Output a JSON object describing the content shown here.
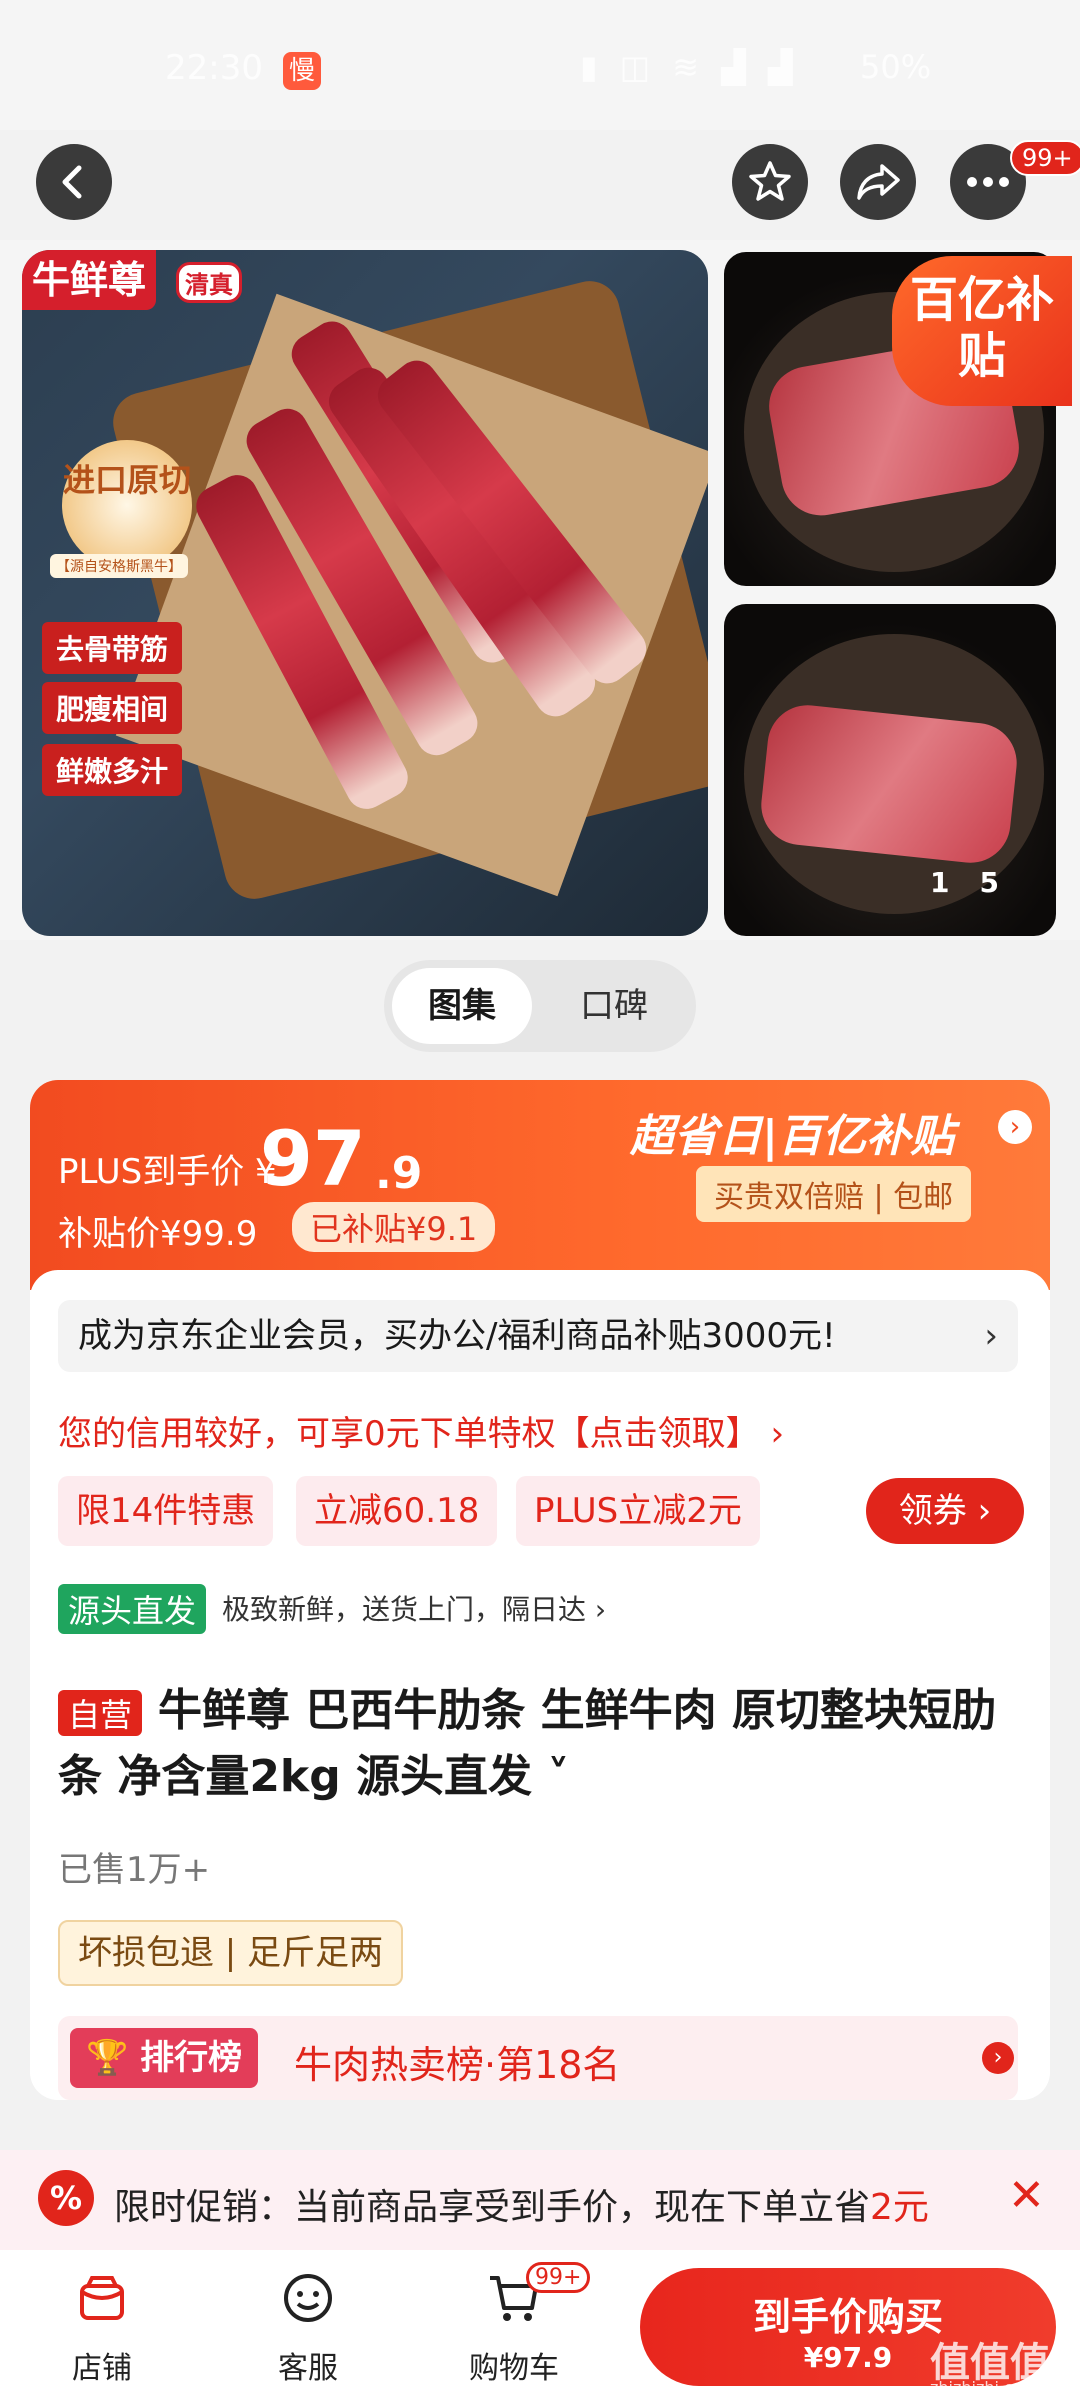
{
  "status": {
    "time": "22:30",
    "slow_badge": "慢",
    "battery": "50%"
  },
  "header": {
    "more_badge": "99+"
  },
  "gallery": {
    "brand_tag": "牛鲜尊",
    "halal": "清真",
    "seal": "进口原切",
    "seal_sub": "【源自安格斯黑牛】",
    "features": [
      "去骨带筋",
      "肥瘦相间",
      "鲜嫩多汁"
    ],
    "subsidy_badge": "百亿补贴",
    "pager_current": "1",
    "pager_total": "5"
  },
  "tabs": {
    "active": "图集",
    "inactive": "口碑"
  },
  "price": {
    "plus_label": "PLUS到手价 ¥",
    "price_int": "97",
    "price_dec": ".9",
    "subsidy_price": "补贴价¥99.9",
    "subsidized": "已补贴¥9.1",
    "promo_title": "超省日|百亿补贴",
    "double_pay": "买贵双倍赔 | 包邮"
  },
  "body": {
    "enterprise": "成为京东企业会员，买办公/福利商品补贴3000元!",
    "credit": "您的信用较好，可享0元下单特权【点击领取】 ›",
    "coupons": [
      "限14件特惠",
      "立减60.18",
      "PLUS立减2元"
    ],
    "get_coupon": "领券",
    "source_tag": "源头直发",
    "source_text": "极致新鲜，送货上门，隔日达 ›",
    "self_tag": "自营",
    "title": "牛鲜尊 巴西牛肋条 生鲜牛肉 原切整块短肋条 净含量2kg 源头直发 ˅",
    "sold": "已售1万+",
    "guarantee": "坏损包退 | 足斤足两",
    "rank_tag": "排行榜",
    "rank_text": "牛肉热卖榜·第18名"
  },
  "promo_bar": {
    "text_before": "限时促销：当前商品享受到手价，现在下单立省",
    "amount": "2元",
    "icon": "%"
  },
  "nav": {
    "shop": "店铺",
    "service": "客服",
    "cart": "购物车",
    "cart_badge": "99+",
    "buy_label": "到手价购买",
    "buy_price": "¥97.9"
  },
  "watermark": {
    "main": "值值值",
    "sub": "zhizhizhi.com"
  }
}
